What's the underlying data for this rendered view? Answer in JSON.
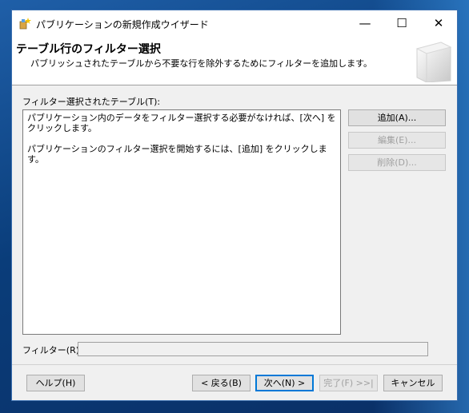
{
  "window": {
    "title": "パブリケーションの新規作成ウイザード",
    "controls": {
      "minimize": "—",
      "maximize": "☐",
      "close": "✕"
    }
  },
  "header": {
    "title": "テーブル行のフィルター選択",
    "subtitle": "パブリッシュされたテーブルから不要な行を除外するためにフィルターを追加します。"
  },
  "main": {
    "tables_label": "フィルター選択されたテーブル(T):",
    "list_messages": [
      "パブリケーション内のデータをフィルター選択する必要がなければ、[次へ] をクリックします。",
      "パブリケーションのフィルター選択を開始するには、[追加] をクリックします。"
    ],
    "buttons": {
      "add": "追加(A)...",
      "edit": "編集(E)...",
      "delete": "削除(D)..."
    },
    "filter_label": "フィルター(R):",
    "filter_value": ""
  },
  "footer": {
    "help": "ヘルプ(H)",
    "back": "< 戻る(B)",
    "next": "次へ(N) >",
    "finish": "完了(F) >>|",
    "cancel": "キャンセル"
  },
  "colors": {
    "accent": "#0078d7",
    "desktop": "#0a3d7a"
  }
}
